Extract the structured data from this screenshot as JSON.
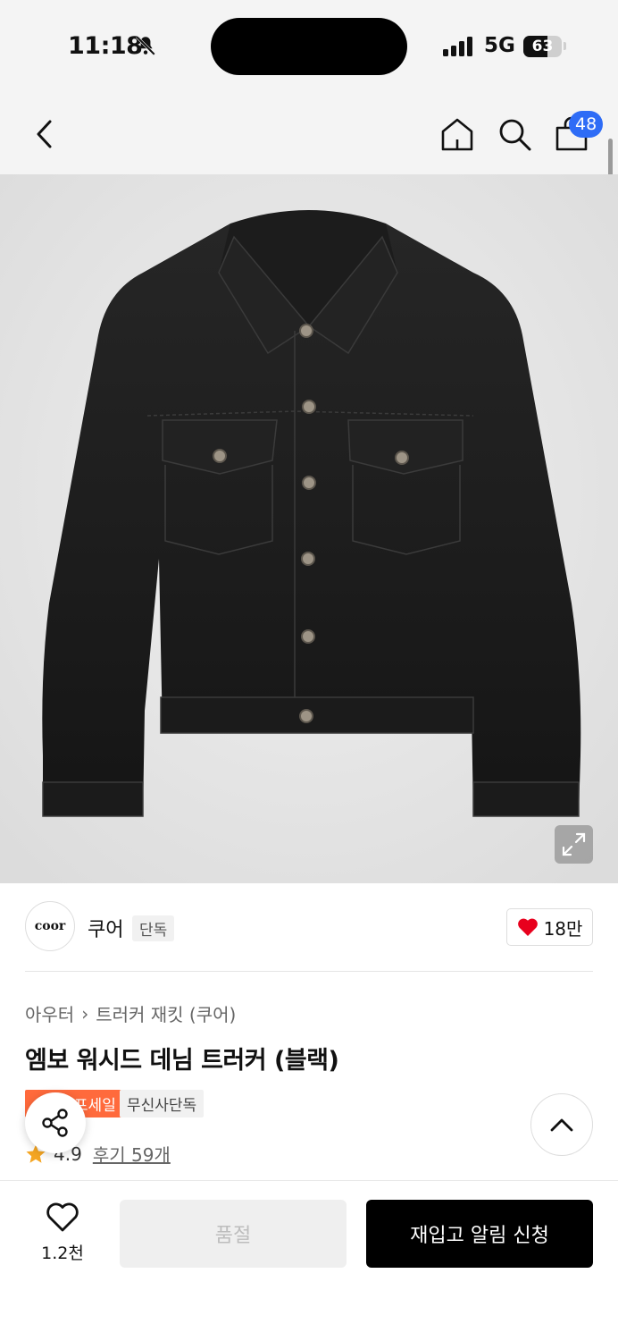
{
  "status_bar": {
    "time": "11:18",
    "network": "5G",
    "battery": "63",
    "battery_level": 0.63
  },
  "nav": {
    "cart_count": "48"
  },
  "product": {
    "brand_logo_text": "coor",
    "brand_name": "쿠어",
    "brand_tag": "단독",
    "like_count": "18만",
    "breadcrumb": [
      "아우터",
      "트러커 재킷 (쿠어)"
    ],
    "title": "엠보 워시드 데님 트러커 (블랙)",
    "badges": {
      "sale": "시즌오프세일",
      "exclusive": "무신사단독"
    },
    "rating": "4.9",
    "reviews_label": "후기 59개"
  },
  "bottom_bar": {
    "wish_count": "1.2천",
    "soldout_label": "품절",
    "restock_label": "재입고 알림 신청"
  },
  "colors": {
    "accent_badge": "#2e6cf6",
    "sale_badge": "#ff6a3c",
    "heart": "#e8001d",
    "star": "#f5a623"
  },
  "icons": [
    "bell-slash-icon",
    "signal-icon",
    "back-chevron-icon",
    "home-icon",
    "search-icon",
    "shopping-bag-icon",
    "expand-icon",
    "heart-icon",
    "share-icon",
    "star-icon",
    "chevron-up-icon",
    "heart-outline-icon"
  ]
}
